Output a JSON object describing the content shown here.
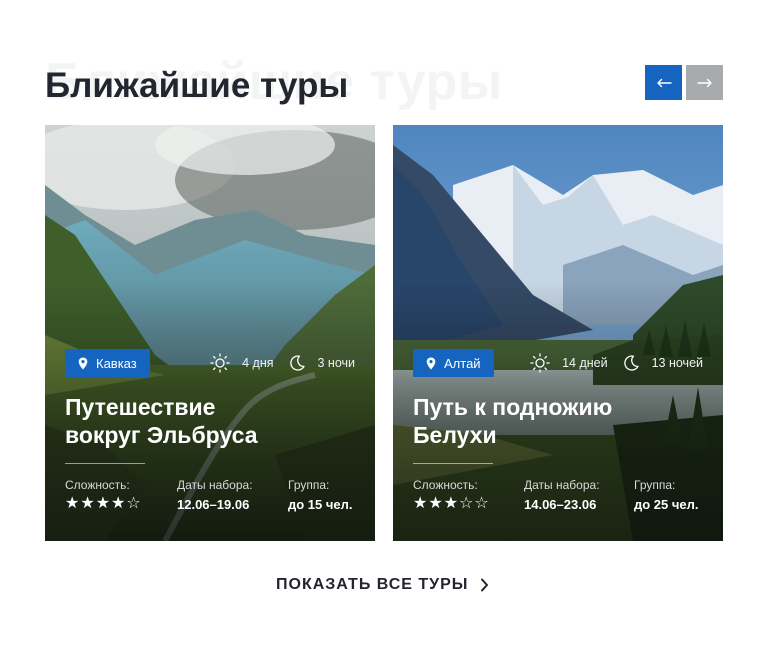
{
  "section": {
    "watermark": "Ближайшие туры",
    "title": "Ближайшие туры"
  },
  "colors": {
    "accent": "#1565c0",
    "nav_inactive": "#a9aaad",
    "title_text": "#23262f"
  },
  "nav": {
    "prev_icon": "arrow-left-icon",
    "next_icon": "arrow-right-icon"
  },
  "tours": [
    {
      "place": "Кавказ",
      "days": "4 дня",
      "nights": "3 ночи",
      "title_line1": "Путешествие",
      "title_line2": "вокруг Эльбруса",
      "difficulty_label": "Сложность:",
      "difficulty_rating": 4,
      "difficulty_max": 5,
      "dates_label": "Даты набора:",
      "dates_value": "12.06–19.06",
      "group_label": "Группа:",
      "group_value": "до 15 чел."
    },
    {
      "place": "Алтай",
      "days": "14 дней",
      "nights": "13 ночей",
      "title_line1": "Путь к подножию",
      "title_line2": "Белухи",
      "difficulty_label": "Сложность:",
      "difficulty_rating": 3,
      "difficulty_max": 5,
      "dates_label": "Даты набора:",
      "dates_value": "14.06–23.06",
      "group_label": "Группа:",
      "group_value": "до 25 чел."
    }
  ],
  "show_all": {
    "label": "ПОКАЗАТЬ ВСЕ ТУРЫ",
    "icon": "chevron-right-icon"
  }
}
